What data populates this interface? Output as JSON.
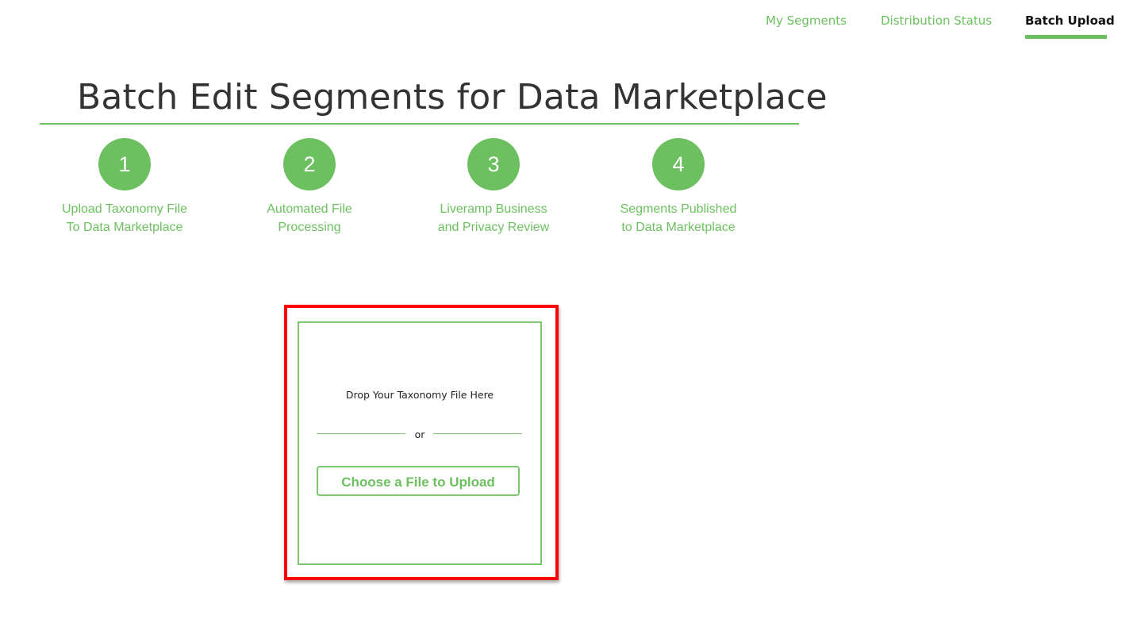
{
  "nav": {
    "tabs": [
      {
        "label": "My Segments",
        "active": false
      },
      {
        "label": "Distribution Status",
        "active": false
      },
      {
        "label": "Batch Upload",
        "active": true
      }
    ]
  },
  "page": {
    "title": "Batch Edit Segments for Data Marketplace"
  },
  "steps": [
    {
      "number": "1",
      "line1": "Upload Taxonomy File",
      "line2": "To Data Marketplace"
    },
    {
      "number": "2",
      "line1": "Automated File",
      "line2": "Processing"
    },
    {
      "number": "3",
      "line1": "Liveramp Business",
      "line2": "and Privacy Review"
    },
    {
      "number": "4",
      "line1": "Segments Published",
      "line2": "to Data Marketplace"
    }
  ],
  "upload": {
    "drop_text": "Drop Your Taxonomy File Here",
    "or_text": "or",
    "button_label": "Choose a File to Upload"
  },
  "colors": {
    "accent": "#6cc05f",
    "highlight": "#ff0000",
    "text": "#333333"
  }
}
